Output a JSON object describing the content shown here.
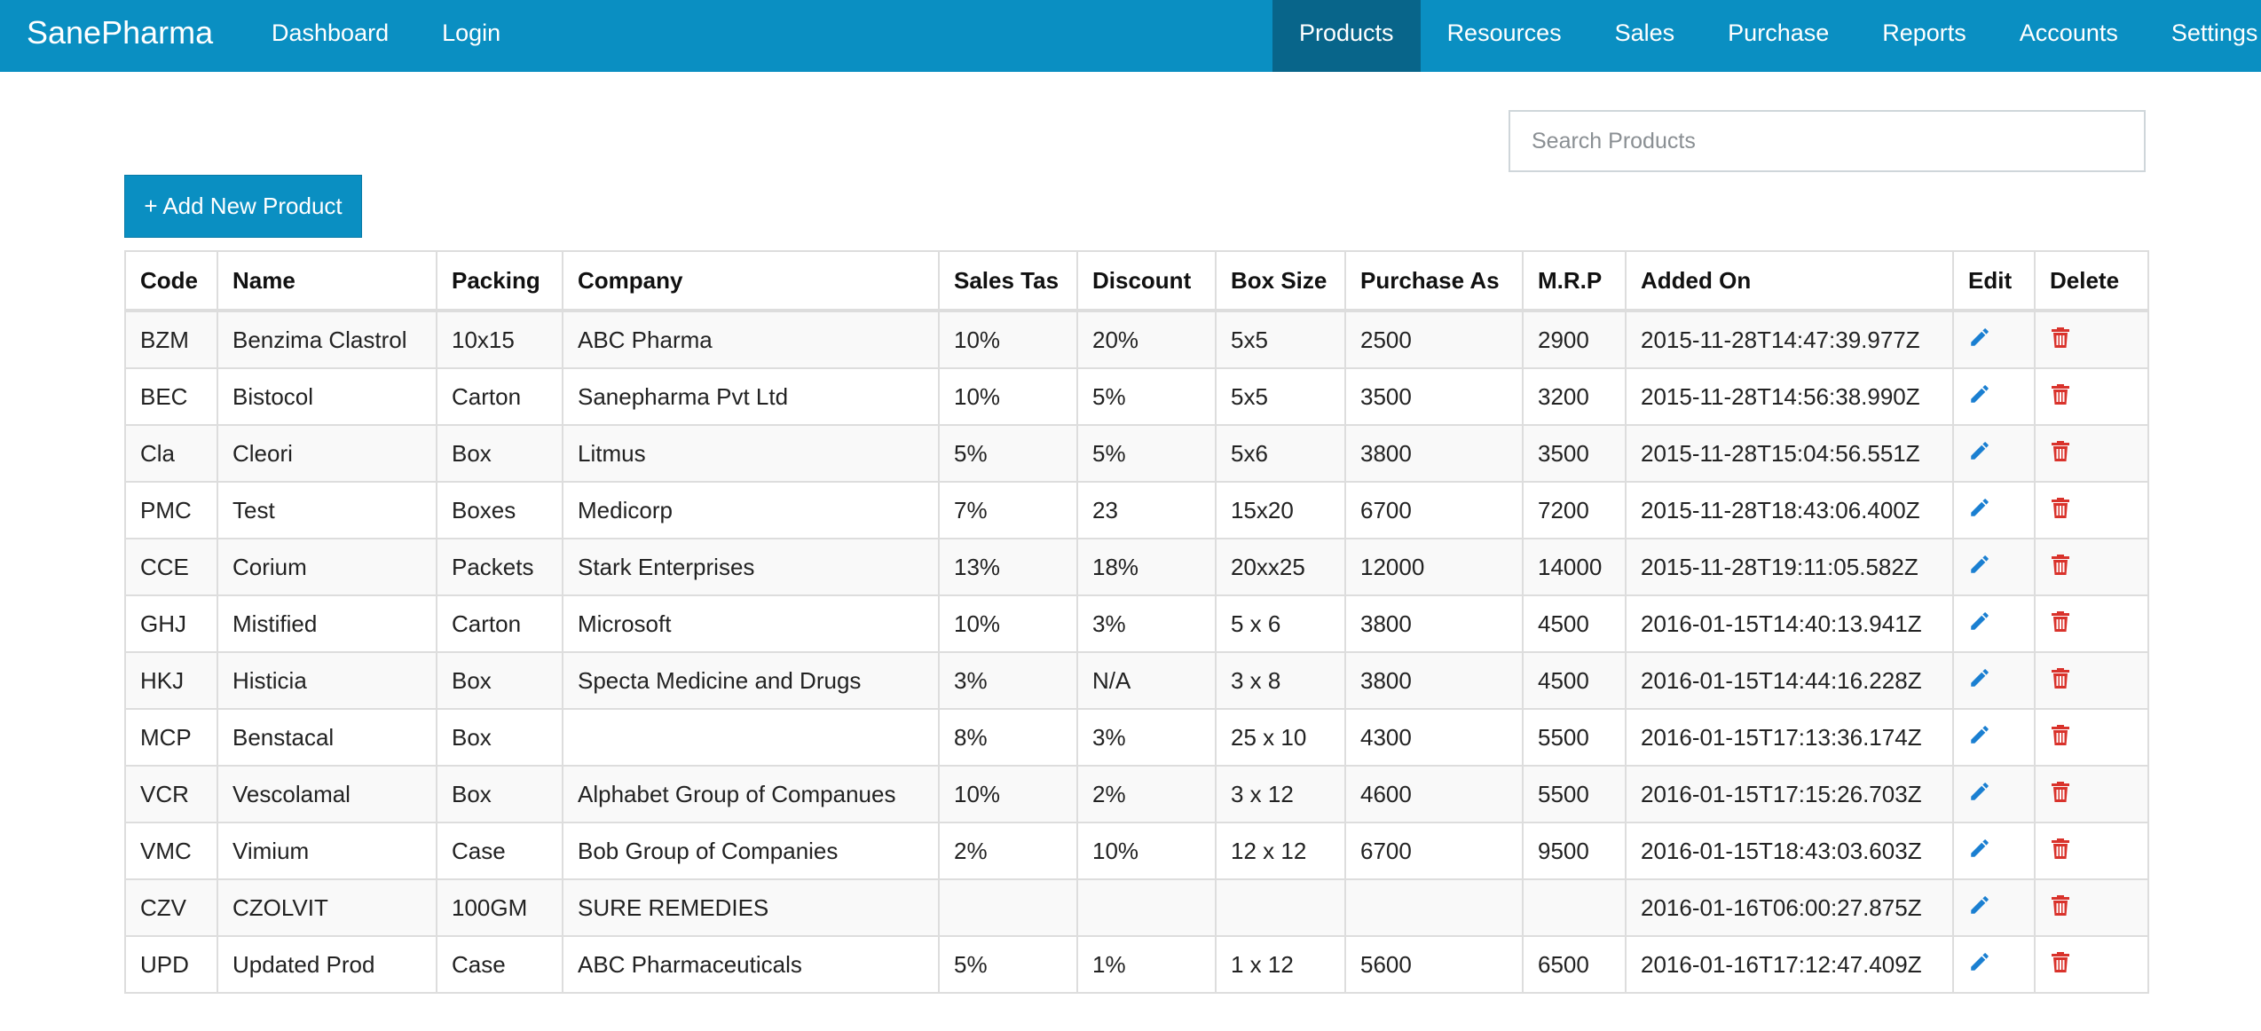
{
  "brand": "SanePharma",
  "nav_left": [
    {
      "label": "Dashboard"
    },
    {
      "label": "Login"
    }
  ],
  "nav_right": [
    {
      "label": "Products",
      "active": true
    },
    {
      "label": "Resources"
    },
    {
      "label": "Sales"
    },
    {
      "label": "Purchase"
    },
    {
      "label": "Reports"
    },
    {
      "label": "Accounts"
    },
    {
      "label": "Settings",
      "dropdown": true
    }
  ],
  "search": {
    "placeholder": "Search Products",
    "value": ""
  },
  "add_button": {
    "label": "+ Add New Product"
  },
  "table": {
    "headers": [
      "Code",
      "Name",
      "Packing",
      "Company",
      "Sales Tas",
      "Discount",
      "Box Size",
      "Purchase As",
      "M.R.P",
      "Added On",
      "Edit",
      "Delete"
    ],
    "rows": [
      [
        "BZM",
        "Benzima Clastrol",
        "10x15",
        "ABC Pharma",
        "10%",
        "20%",
        "5x5",
        "2500",
        "2900",
        "2015-11-28T14:47:39.977Z"
      ],
      [
        "BEC",
        "Bistocol",
        "Carton",
        "Sanepharma Pvt Ltd",
        "10%",
        "5%",
        "5x5",
        "3500",
        "3200",
        "2015-11-28T14:56:38.990Z"
      ],
      [
        "Cla",
        "Cleori",
        "Box",
        "Litmus",
        "5%",
        "5%",
        "5x6",
        "3800",
        "3500",
        "2015-11-28T15:04:56.551Z"
      ],
      [
        "PMC",
        "Test",
        "Boxes",
        "Medicorp",
        "7%",
        "23",
        "15x20",
        "6700",
        "7200",
        "2015-11-28T18:43:06.400Z"
      ],
      [
        "CCE",
        "Corium",
        "Packets",
        "Stark Enterprises",
        "13%",
        "18%",
        "20xx25",
        "12000",
        "14000",
        "2015-11-28T19:11:05.582Z"
      ],
      [
        "GHJ",
        "Mistified",
        "Carton",
        "Microsoft",
        "10%",
        "3%",
        "5 x 6",
        "3800",
        "4500",
        "2016-01-15T14:40:13.941Z"
      ],
      [
        "HKJ",
        "Histicia",
        "Box",
        "Specta Medicine and Drugs",
        "3%",
        "N/A",
        "3 x 8",
        "3800",
        "4500",
        "2016-01-15T14:44:16.228Z"
      ],
      [
        "MCP",
        "Benstacal",
        "Box",
        "",
        "8%",
        "3%",
        "25 x 10",
        "4300",
        "5500",
        "2016-01-15T17:13:36.174Z"
      ],
      [
        "VCR",
        "Vescolamal",
        "Box",
        "Alphabet Group of Companues",
        "10%",
        "2%",
        "3 x 12",
        "4600",
        "5500",
        "2016-01-15T17:15:26.703Z"
      ],
      [
        "VMC",
        "Vimium",
        "Case",
        "Bob Group of Companies",
        "2%",
        "10%",
        "12 x 12",
        "6700",
        "9500",
        "2016-01-15T18:43:03.603Z"
      ],
      [
        "CZV",
        "CZOLVIT",
        "100GM",
        "SURE REMEDIES",
        "",
        "",
        "",
        "",
        "",
        "2016-01-16T06:00:27.875Z"
      ],
      [
        "UPD",
        "Updated Prod",
        "Case",
        "ABC Pharmaceuticals",
        "5%",
        "1%",
        "1 x 12",
        "5600",
        "6500",
        "2016-01-16T17:12:47.409Z"
      ]
    ]
  },
  "icons": {
    "edit": "pencil-icon",
    "delete": "trash-icon"
  },
  "colors": {
    "navbar": "#0a8fc2",
    "nav_active": "#08658a",
    "edit_icon": "#1a7fd1",
    "delete_icon": "#d9322b"
  }
}
